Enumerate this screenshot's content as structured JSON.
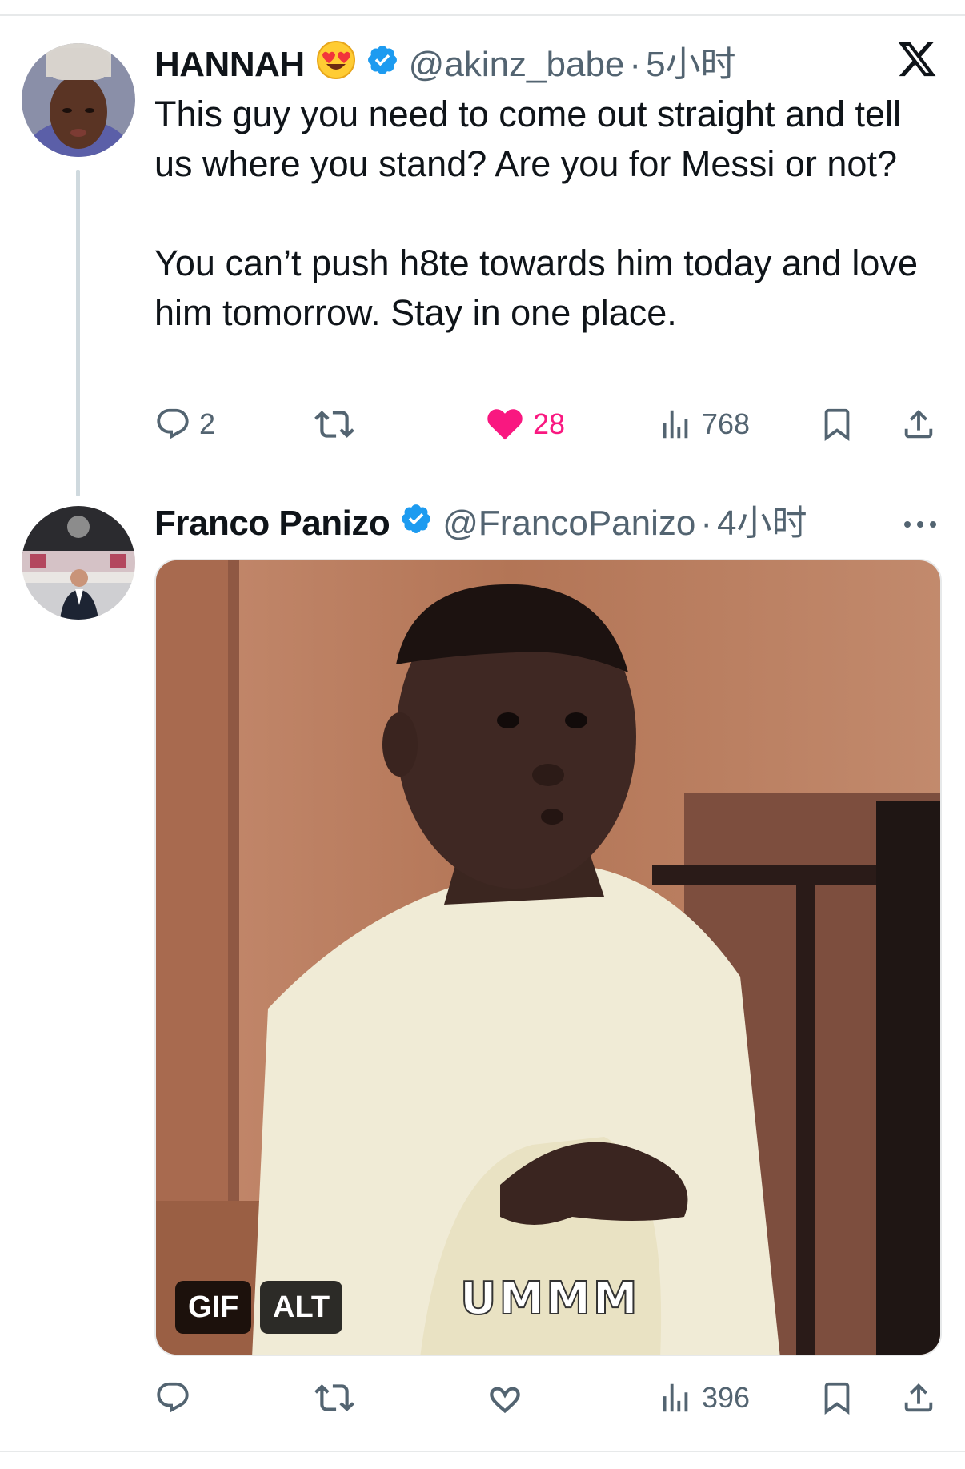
{
  "tweets": [
    {
      "display_name": "HANNAH",
      "name_emoji": "😍",
      "handle": "@akinz_babe",
      "separator": "·",
      "time": "5小时",
      "text_paragraphs": [
        "This guy you need to come out straight and tell us where you stand? Are you for Messi or not?",
        "You can’t push h8te towards him today and love him tomorrow. Stay in one place."
      ],
      "replies": "2",
      "reposts": "",
      "likes": "28",
      "liked": true,
      "views": "768"
    },
    {
      "display_name": "Franco Panizo",
      "handle": "@FrancoPanizo",
      "separator": "·",
      "time": "4小时",
      "media": {
        "gif_badge": "GIF",
        "alt_badge": "ALT",
        "caption": "UMMM"
      },
      "replies": "",
      "reposts": "",
      "likes": "",
      "liked": false,
      "views": "396"
    }
  ],
  "icons": {
    "platform_logo": "x-logo-icon",
    "more": "more-icon",
    "verified": "verified-badge-icon",
    "reply": "reply-icon",
    "repost": "repost-icon",
    "like": "heart-icon",
    "views": "views-icon",
    "bookmark": "bookmark-icon",
    "share": "share-icon"
  },
  "colors": {
    "verified_blue": "#1d9bf0",
    "like_pink": "#f91880",
    "secondary_text": "#536471",
    "thread_line": "#cfd9de"
  }
}
